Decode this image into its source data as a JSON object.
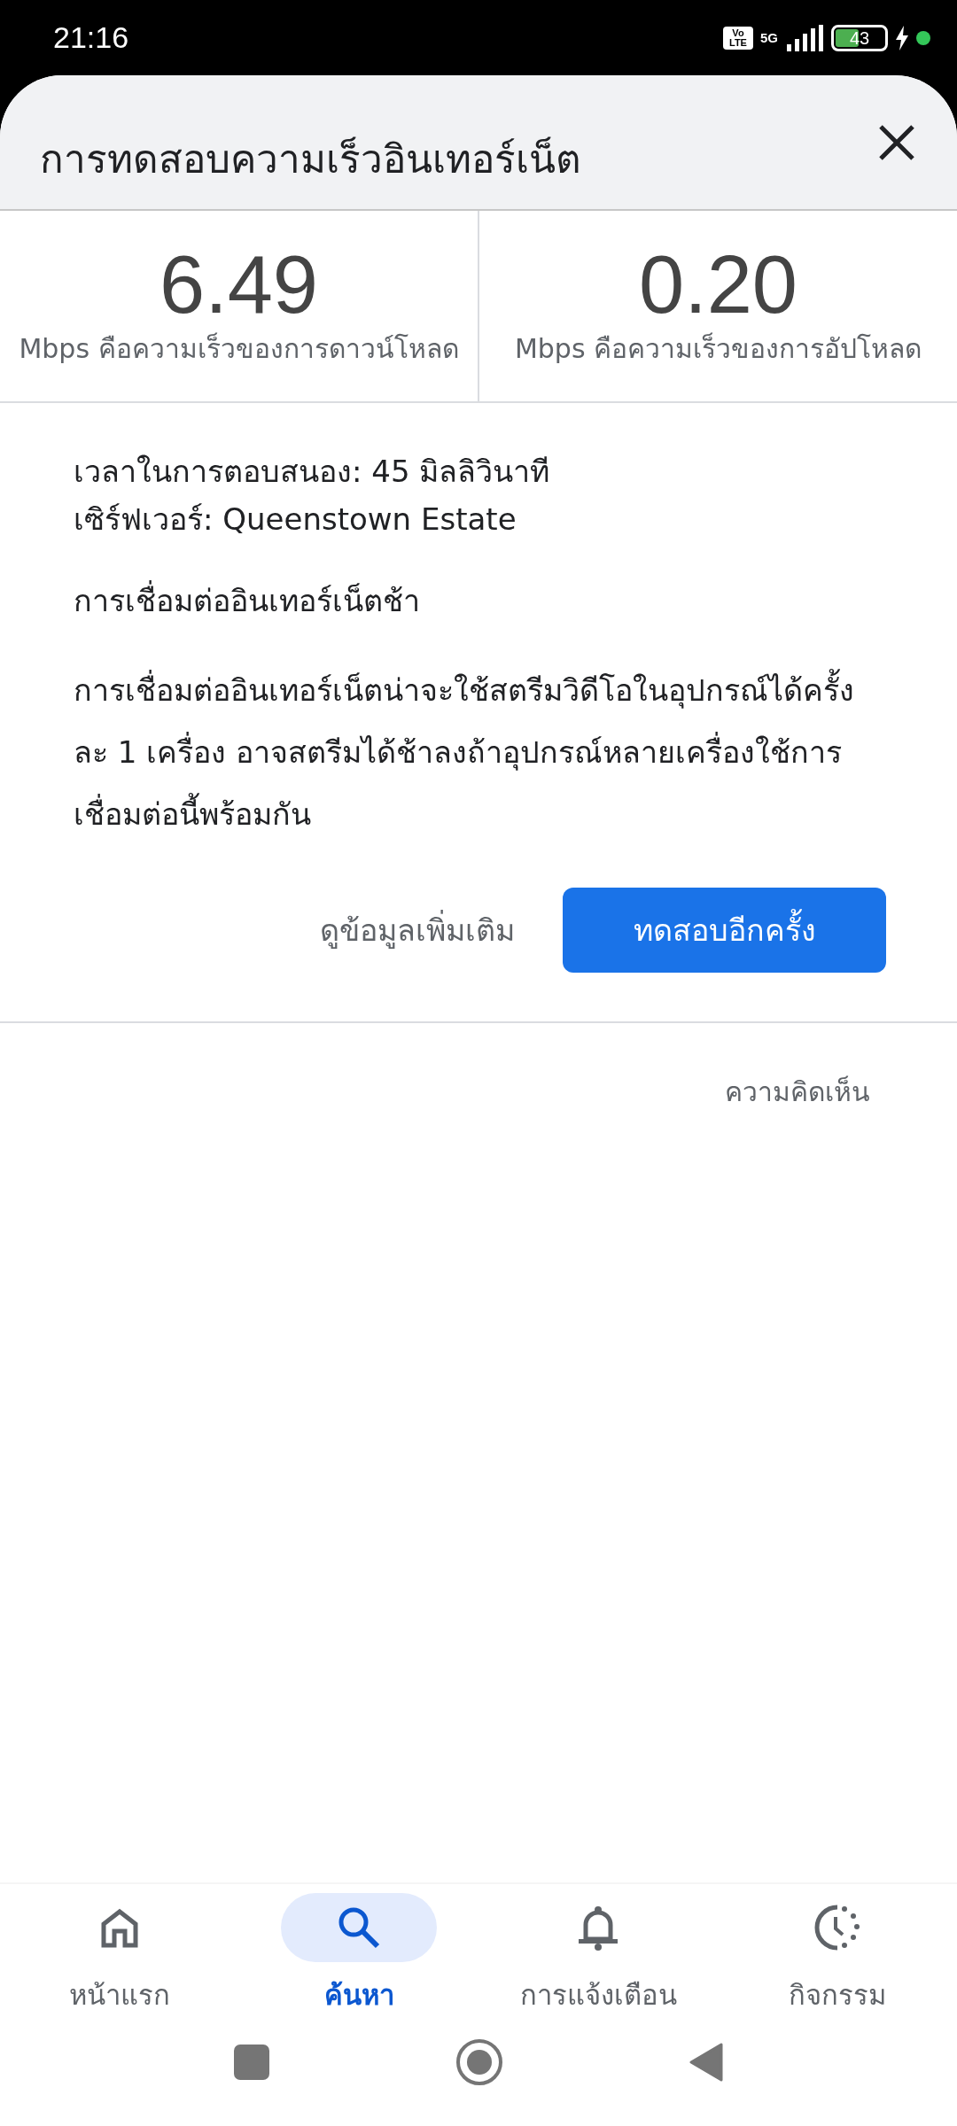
{
  "status_bar": {
    "time": "21:16",
    "volte": "Vo LTE",
    "network": "5G",
    "battery": "43"
  },
  "sheet": {
    "title": "การทดสอบความเร็วอินเทอร์เน็ต"
  },
  "results": [
    {
      "value": "6.49",
      "label": "Mbps คือความเร็วของการดาวน์โหลด"
    },
    {
      "value": "0.20",
      "label": "Mbps คือความเร็วของการอัปโหลด"
    }
  ],
  "details": {
    "latency": "เวลาในการตอบสนอง: 45 มิลลิวินาที",
    "server": "เซิร์ฟเวอร์: Queenstown Estate"
  },
  "verdict": "การเชื่อมต่ออินเทอร์เน็ตช้า",
  "description": "การเชื่อมต่ออินเทอร์เน็ตน่าจะใช้สตรีมวิดีโอในอุปกรณ์ได้ครั้งละ 1 เครื่อง อาจสตรีมได้ช้าลงถ้าอุปกรณ์หลายเครื่องใช้การเชื่อมต่อนี้พร้อมกัน",
  "buttons": {
    "learn_more": "ดูข้อมูลเพิ่มเติม",
    "retry": "ทดสอบอีกครั้ง"
  },
  "feedback": "ความคิดเห็น",
  "bottom_nav": [
    {
      "kind": "home",
      "label": "หน้าแรก",
      "selected": false
    },
    {
      "kind": "search",
      "label": "ค้นหา",
      "selected": true
    },
    {
      "kind": "bell",
      "label": "การแจ้งเตือน",
      "selected": false
    },
    {
      "kind": "activity",
      "label": "กิจกรรม",
      "selected": false
    }
  ]
}
